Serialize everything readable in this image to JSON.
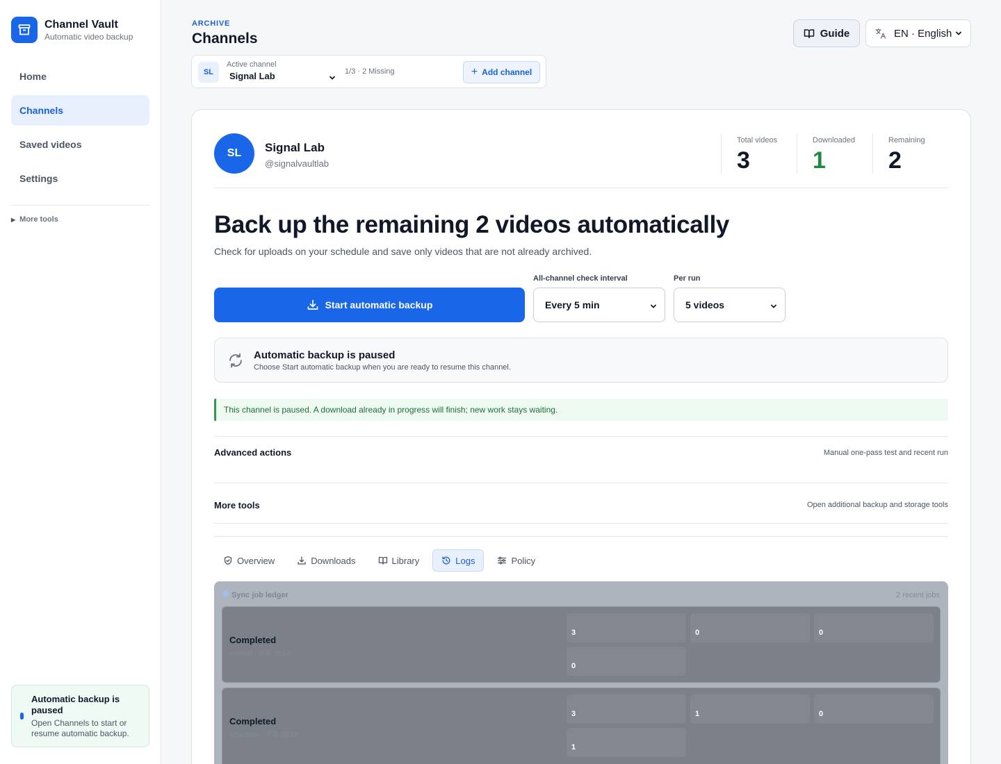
{
  "brand": {
    "name": "Channel Vault",
    "subtitle": "Automatic video backup"
  },
  "nav": {
    "items": [
      {
        "label": "Home",
        "active": false
      },
      {
        "label": "Channels",
        "active": true
      },
      {
        "label": "Saved videos",
        "active": false
      },
      {
        "label": "Settings",
        "active": false
      }
    ],
    "more_tools": "More tools"
  },
  "sidebar_status": {
    "title": "Automatic backup is paused",
    "body": "Open Channels to start or resume automatic backup."
  },
  "header": {
    "eyebrow": "ARCHIVE",
    "title": "Channels",
    "guide_label": "Guide",
    "language_label": "EN · English"
  },
  "switcher": {
    "avatar": "SL",
    "label": "Active channel",
    "selected": "Signal Lab",
    "meta": "1/3 · 2 Missing",
    "add_label": "Add channel"
  },
  "channel": {
    "avatar": "SL",
    "name": "Signal Lab",
    "handle": "@signalvaultlab",
    "stats": [
      {
        "label": "Total videos",
        "value": "3"
      },
      {
        "label": "Downloaded",
        "value": "1"
      },
      {
        "label": "Remaining",
        "value": "2"
      }
    ]
  },
  "hero": {
    "title": "Back up the remaining 2 videos automatically",
    "subtitle": "Check for uploads on your schedule and save only videos that are not already archived."
  },
  "controls": {
    "start_label": "Start automatic backup",
    "interval_label": "All-channel check interval",
    "interval_value": "Every 5 min",
    "per_run_label": "Per run",
    "per_run_value": "5 videos"
  },
  "paused": {
    "title": "Automatic backup is paused",
    "body": "Choose Start automatic backup when you are ready to resume this channel."
  },
  "alert": "This channel is paused. A download already in progress will finish; new work stays waiting.",
  "sections": {
    "advanced": {
      "title": "Advanced actions",
      "meta": "Manual one-pass test and recent run"
    },
    "more": {
      "title": "More tools",
      "meta": "Open additional backup and storage tools"
    }
  },
  "tabs": [
    {
      "label": "Overview",
      "icon": "shield-check-icon",
      "active": false
    },
    {
      "label": "Downloads",
      "icon": "download-icon",
      "active": false
    },
    {
      "label": "Library",
      "icon": "book-icon",
      "active": false
    },
    {
      "label": "Logs",
      "icon": "history-icon",
      "active": true
    },
    {
      "label": "Policy",
      "icon": "sliders-icon",
      "active": false
    }
  ],
  "logs": {
    "title": "Sync job ledger",
    "count": "2 recent jobs",
    "jobs": [
      {
        "status": "Completed",
        "sub": "manual · 오후 05:54",
        "metrics": [
          "3",
          "0",
          "0",
          "0"
        ]
      },
      {
        "status": "Completed",
        "sub": "scheduler · 오후 05:18",
        "metrics": [
          "3",
          "1",
          "0",
          "1"
        ]
      }
    ]
  },
  "colors": {
    "accent": "#1a66e8",
    "success": "#1f8a3f"
  }
}
